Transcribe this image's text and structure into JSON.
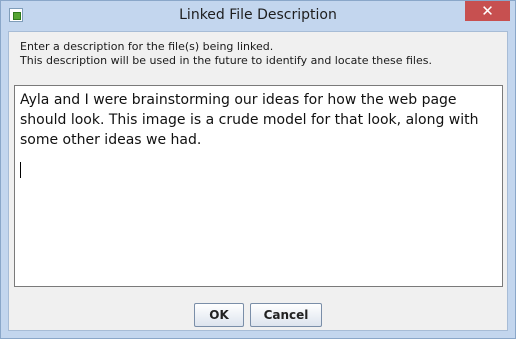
{
  "window": {
    "title": "Linked File Description",
    "app_icon": "document-link-icon",
    "close_glyph": "✕"
  },
  "instructions": {
    "line1": "Enter a description for the file(s) being linked.",
    "line2": "This description will be used in the future to identify and locate these files."
  },
  "description": {
    "value": "Ayla and I were brainstorming our ideas for how the web page should look. This image is a crude model for that look, along with some other ideas we had."
  },
  "buttons": {
    "ok_label": "OK",
    "cancel_label": "Cancel"
  },
  "colors": {
    "titlebar": "#c3d6ee",
    "close_button": "#c75050",
    "client_background": "#f0f0f0"
  }
}
